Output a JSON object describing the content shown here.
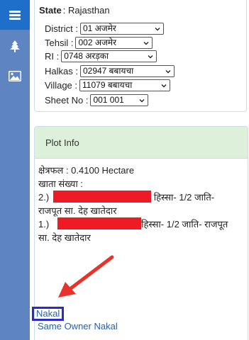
{
  "location": {
    "state_label": "State",
    "state_value": ": Rajasthan",
    "district_label": "District :",
    "district_value": "01 अजमेर",
    "tehsil_label": "Tehsil :",
    "tehsil_value": "002 अजमेर",
    "ri_label": "RI :",
    "ri_value": "0748 अरड़का",
    "halkas_label": "Halkas :",
    "halkas_value": "02947 बबायचा",
    "village_label": "Village :",
    "village_value": "11079 बबायचा",
    "sheet_label": "Sheet No :",
    "sheet_value": "001 001"
  },
  "plot_info": {
    "title": "Plot Info",
    "area_text": "क्षेत्रफल : 0.4100 Hectare",
    "khata_text": "खाता संख्या :",
    "owner2_prefix": "2.)",
    "owner2_suffix": " हिस्सा- 1/2 जाति-",
    "owner2_line2": "राजपूत सा. देह खातेदार",
    "owner1_prefix": "1.)",
    "owner1_suffix": "हिस्सा- 1/2 जाति- राजपूत",
    "owner1_line2": "सा. देह खातेदार",
    "nakal_link": "Nakal",
    "same_owner_link": "Same Owner Nakal"
  },
  "icons": [
    "menu-icon",
    "tree-icon",
    "image-icon",
    "chevron-down-icon"
  ],
  "colors": {
    "rail": "#5f84c2",
    "rail_active": "#1e6fc9",
    "plot_header": "#ddf0da",
    "link": "#2c5fa8",
    "redaction": "#ee1b24",
    "highlight_box": "#2b2bc9",
    "arrow": "#e8322b"
  }
}
